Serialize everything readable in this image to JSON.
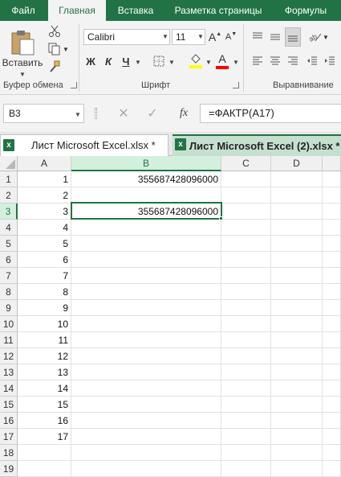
{
  "ribbon_tabs": [
    "Файл",
    "Главная",
    "Вставка",
    "Разметка страницы",
    "Формулы"
  ],
  "ribbon": {
    "paste_label": "Вставить",
    "clipboard_group": "Буфер обмена",
    "font_group": "Шрифт",
    "align_group": "Выравнивание",
    "font_name": "Calibri",
    "font_size": "11",
    "bold": "Ж",
    "italic": "К",
    "underline": "Ч",
    "grow_font": "A",
    "shrink_font": "A",
    "font_color_letter": "A",
    "colors": {
      "accent": "#217346",
      "highlight_fill": "#ffff00",
      "font_color": "#ff0000"
    }
  },
  "formula_bar": {
    "name_box": "B3",
    "fx": "fx",
    "formula": "=ФАКТР(A17)"
  },
  "workbooks": [
    {
      "name": "Лист Microsoft Excel.xlsx *",
      "active": false
    },
    {
      "name": "Лист Microsoft Excel (2).xlsx *",
      "active": true
    }
  ],
  "grid": {
    "columns": [
      "A",
      "B",
      "C",
      "D"
    ],
    "rows": [
      {
        "n": "1",
        "a": "1",
        "b": "355687428096000"
      },
      {
        "n": "2",
        "a": "2",
        "b": ""
      },
      {
        "n": "3",
        "a": "3",
        "b": "355687428096000"
      },
      {
        "n": "4",
        "a": "4",
        "b": ""
      },
      {
        "n": "5",
        "a": "5",
        "b": ""
      },
      {
        "n": "6",
        "a": "6",
        "b": ""
      },
      {
        "n": "7",
        "a": "7",
        "b": ""
      },
      {
        "n": "8",
        "a": "8",
        "b": ""
      },
      {
        "n": "9",
        "a": "9",
        "b": ""
      },
      {
        "n": "10",
        "a": "10",
        "b": ""
      },
      {
        "n": "11",
        "a": "11",
        "b": ""
      },
      {
        "n": "12",
        "a": "12",
        "b": ""
      },
      {
        "n": "13",
        "a": "13",
        "b": ""
      },
      {
        "n": "14",
        "a": "14",
        "b": ""
      },
      {
        "n": "15",
        "a": "15",
        "b": ""
      },
      {
        "n": "16",
        "a": "16",
        "b": ""
      },
      {
        "n": "17",
        "a": "17",
        "b": ""
      },
      {
        "n": "18",
        "a": "",
        "b": ""
      },
      {
        "n": "19",
        "a": "",
        "b": ""
      }
    ],
    "selected_col": "B",
    "selected_row": "3"
  }
}
